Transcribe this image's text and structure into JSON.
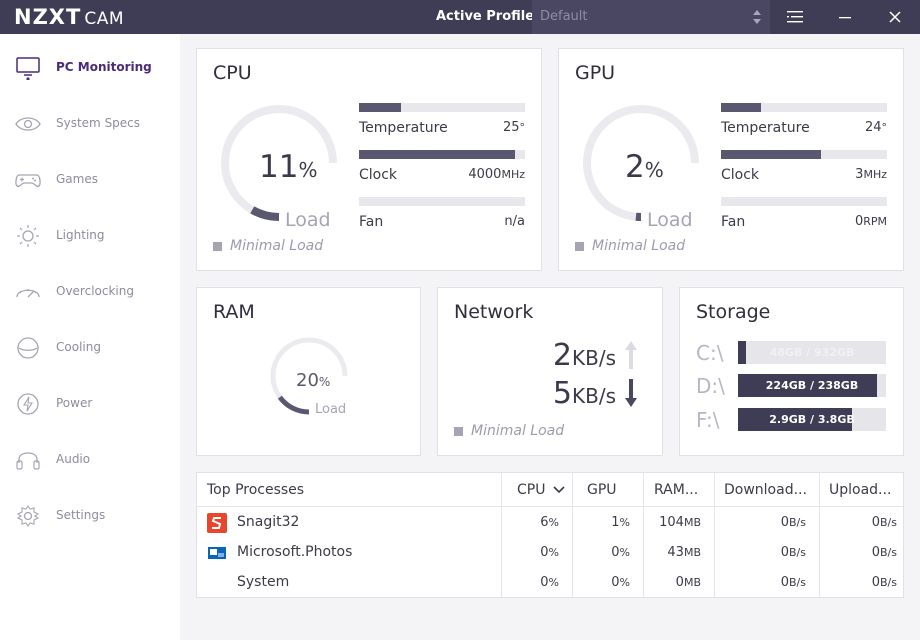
{
  "app": {
    "brand": "NZXT",
    "product": "CAM"
  },
  "profile": {
    "label": "Active Profile:",
    "value": "Default"
  },
  "sidebar": {
    "items": [
      {
        "label": "PC Monitoring",
        "icon": "monitor-icon",
        "active": true
      },
      {
        "label": "System Specs",
        "icon": "eye-icon",
        "active": false
      },
      {
        "label": "Games",
        "icon": "gamepad-icon",
        "active": false
      },
      {
        "label": "Lighting",
        "icon": "sun-icon",
        "active": false
      },
      {
        "label": "Overclocking",
        "icon": "speedometer-icon",
        "active": false
      },
      {
        "label": "Cooling",
        "icon": "fan-icon",
        "active": false
      },
      {
        "label": "Power",
        "icon": "bolt-icon",
        "active": false
      },
      {
        "label": "Audio",
        "icon": "headphones-icon",
        "active": false
      },
      {
        "label": "Settings",
        "icon": "gear-icon",
        "active": false
      }
    ]
  },
  "cpu": {
    "title": "CPU",
    "load_value": "11",
    "load_unit": "%",
    "load_fraction": 0.11,
    "load_label": "Load",
    "status": "Minimal Load",
    "metrics": [
      {
        "label": "Temperature",
        "value": "25",
        "unit": "°",
        "fill": 0.25
      },
      {
        "label": "Clock",
        "value": "4000",
        "unit": "MHz",
        "fill": 0.94
      },
      {
        "label": "Fan",
        "value": "n/a",
        "unit": "",
        "fill": 0
      }
    ]
  },
  "gpu": {
    "title": "GPU",
    "load_value": "2",
    "load_unit": "%",
    "load_fraction": 0.02,
    "load_label": "Load",
    "status": "Minimal Load",
    "metrics": [
      {
        "label": "Temperature",
        "value": "24",
        "unit": "°",
        "fill": 0.24
      },
      {
        "label": "Clock",
        "value": "3",
        "unit": "MHz",
        "fill": 0.6
      },
      {
        "label": "Fan",
        "value": "0",
        "unit": "RPM",
        "fill": 0
      }
    ]
  },
  "ram": {
    "title": "RAM",
    "load_value": "20",
    "load_unit": "%",
    "load_fraction": 0.2,
    "load_label": "Load"
  },
  "network": {
    "title": "Network",
    "upload_value": "2",
    "upload_unit": "KB/s",
    "download_value": "5",
    "download_unit": "KB/s",
    "status": "Minimal Load"
  },
  "storage": {
    "title": "Storage",
    "drives": [
      {
        "drive": "C:\\",
        "text": "48GB / 932GB",
        "fill": 0.052
      },
      {
        "drive": "D:\\",
        "text": "224GB / 238GB",
        "fill": 0.94
      },
      {
        "drive": "F:\\",
        "text": "2.9GB / 3.8GB",
        "fill": 0.77
      }
    ]
  },
  "processes": {
    "headers": [
      "Top Processes",
      "CPU",
      "GPU",
      "RAM...",
      "Download...",
      "Upload..."
    ],
    "rows": [
      {
        "name": "Snagit32",
        "icon": "snagit-icon",
        "cpu": "6",
        "gpu": "1",
        "ram": "104",
        "down": "0",
        "up": "0"
      },
      {
        "name": "Microsoft.Photos",
        "icon": "photos-icon",
        "cpu": "0",
        "gpu": "0",
        "ram": "43",
        "down": "0",
        "up": "0"
      },
      {
        "name": "System",
        "icon": "",
        "cpu": "0",
        "gpu": "0",
        "ram": "0",
        "down": "0",
        "up": "0"
      }
    ],
    "units": {
      "pct": "%",
      "mb": "MB",
      "rate": "B/s"
    }
  },
  "colors": {
    "titlebar": "#3f3c55",
    "accent": "#4b2a7a",
    "bar": "#5a5870",
    "track": "#e8e8ec"
  }
}
